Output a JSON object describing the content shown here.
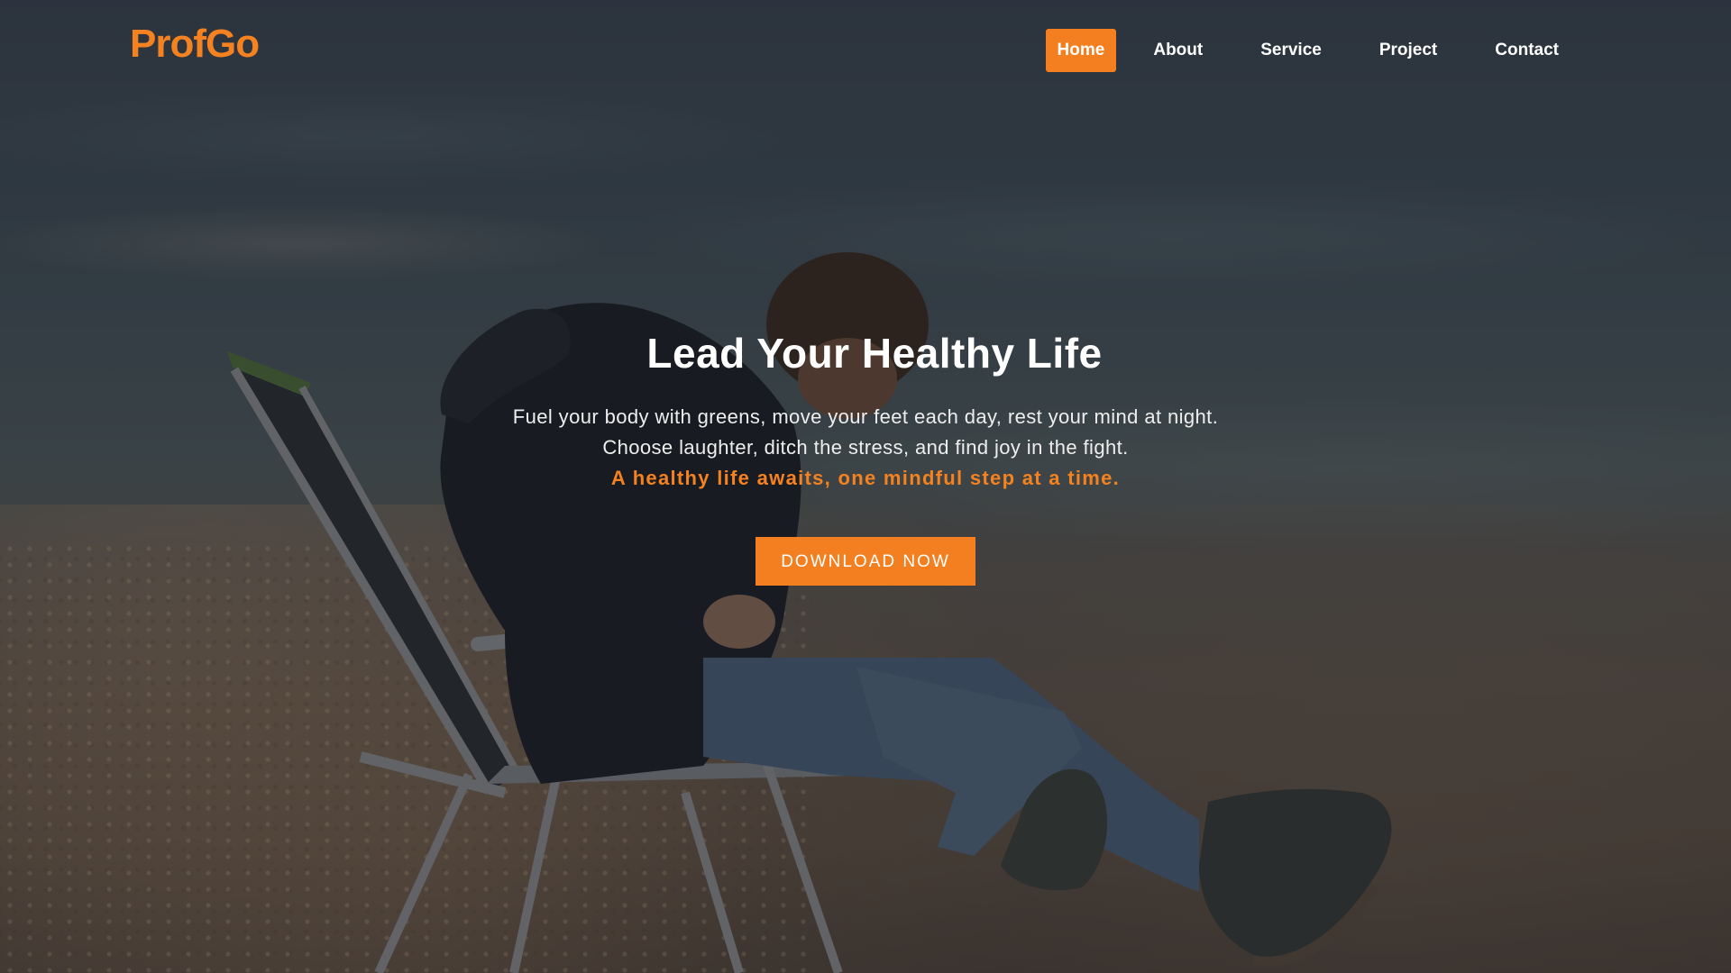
{
  "brand": {
    "name": "ProfGo"
  },
  "nav": {
    "items": [
      {
        "label": "Home",
        "active": true
      },
      {
        "label": "About",
        "active": false
      },
      {
        "label": "Service",
        "active": false
      },
      {
        "label": "Project",
        "active": false
      },
      {
        "label": "Contact",
        "active": false
      }
    ]
  },
  "hero": {
    "headline": "Lead Your Healthy Life",
    "description": "Fuel your body with greens, move your feet each day, rest your mind at night. Choose laughter, ditch the stress, and find joy in the fight.",
    "tagline": "A healthy life awaits, one mindful step at a time.",
    "cta_label": "DOWNLOAD NOW"
  },
  "colors": {
    "accent": "#f37f21",
    "text": "#ffffff"
  }
}
